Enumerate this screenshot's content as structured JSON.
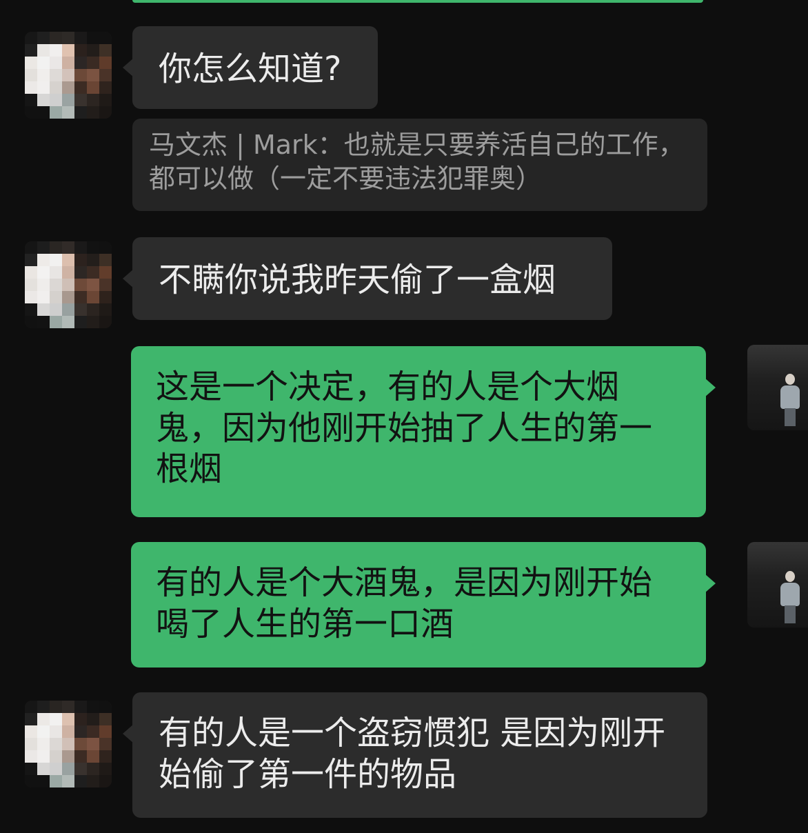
{
  "chat": {
    "messages": [
      {
        "from": "other",
        "text": "你怎么知道?"
      },
      {
        "from": "quote",
        "text": "马文杰 | Mark：也就是只要养活自己的工作，都可以做（一定不要违法犯罪奥）"
      },
      {
        "from": "other",
        "text": "不瞒你说我昨天偷了一盒烟"
      },
      {
        "from": "self",
        "text": "这是一个决定，有的人是个大烟鬼，因为他刚开始抽了人生的第一根烟"
      },
      {
        "from": "self",
        "text": "有的人是个大酒鬼，是因为刚开始喝了人生的第一口酒"
      },
      {
        "from": "other",
        "text": "有的人是一个盗窃惯犯 是因为刚开始偷了第一件的物品"
      }
    ]
  },
  "colors": {
    "background": "#0e0e0e",
    "incoming_bubble": "#2c2c2c",
    "outgoing_bubble": "#3fb66c",
    "quote_bubble": "#252525",
    "incoming_text": "#ececec",
    "outgoing_text": "#121212",
    "quote_text": "#9d9d9d"
  },
  "icons": {
    "other_avatar": "pixelated-avatar-icon",
    "self_avatar": "person-photo-avatar-icon"
  }
}
